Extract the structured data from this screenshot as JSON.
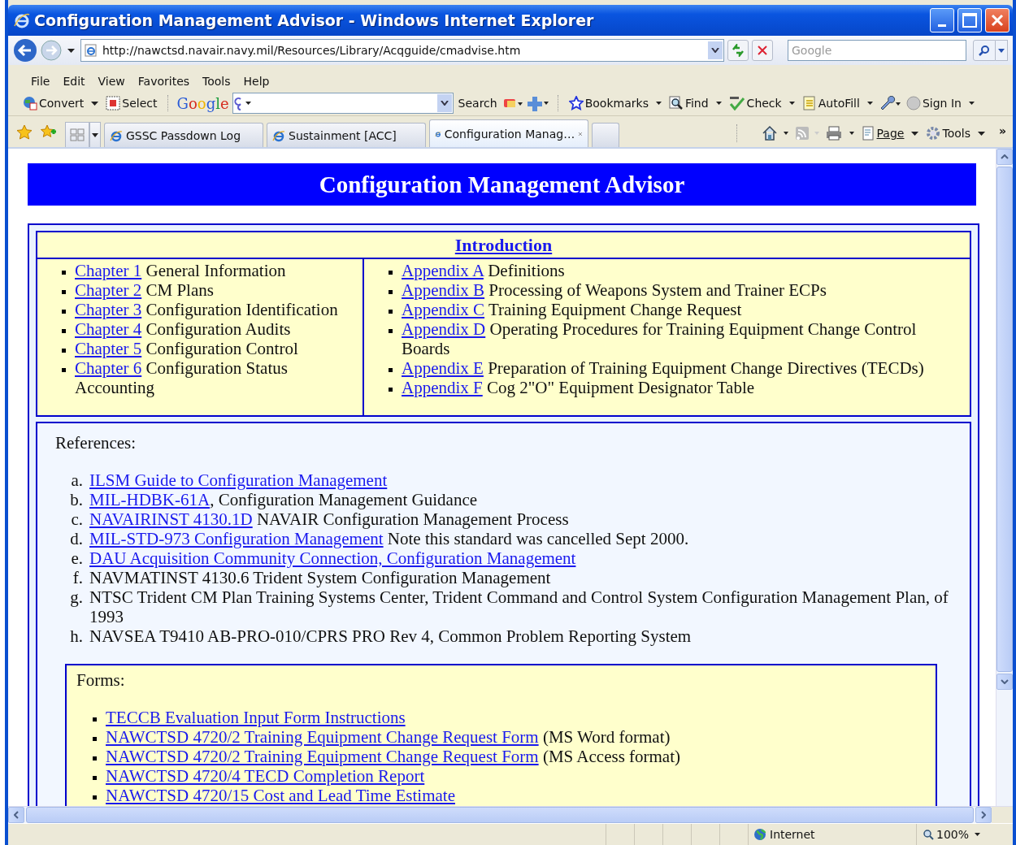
{
  "window": {
    "title": "Configuration Management Advisor - Windows Internet Explorer"
  },
  "address_bar": {
    "url": "http://nawctsd.navair.navy.mil/Resources/Library/Acqguide/cmadvise.htm"
  },
  "search_box": {
    "placeholder": "Google"
  },
  "menu": [
    "File",
    "Edit",
    "View",
    "Favorites",
    "Tools",
    "Help"
  ],
  "toolbar": {
    "items": [
      {
        "kind": "convert",
        "label": "Convert"
      },
      {
        "kind": "select",
        "label": "Select"
      }
    ],
    "logo": "Google",
    "search_label": "Search",
    "right_items": [
      {
        "kind": "bookmarks",
        "label": "Bookmarks"
      },
      {
        "kind": "find",
        "label": "Find"
      },
      {
        "kind": "check",
        "label": "Check"
      },
      {
        "kind": "autofill",
        "label": "AutoFill"
      },
      {
        "kind": "signin",
        "label": "Sign In"
      }
    ]
  },
  "tabs": [
    {
      "label": "GSSC Passdown Log",
      "selected": false
    },
    {
      "label": "Sustainment [ACC]",
      "selected": false
    },
    {
      "label": "Configuration Manag…",
      "selected": true
    }
  ],
  "command_bar": {
    "page": "Page",
    "tools": "Tools",
    "more": "»"
  },
  "page": {
    "heading": "Configuration Management Advisor",
    "intro": "Introduction",
    "chapters": [
      {
        "link": "Chapter 1",
        "text": "General Information"
      },
      {
        "link": "Chapter 2",
        "text": "CM Plans"
      },
      {
        "link": "Chapter 3",
        "text": "Configuration Identification"
      },
      {
        "link": "Chapter 4",
        "text": "Configuration Audits"
      },
      {
        "link": "Chapter 5",
        "text": "Configuration Control"
      },
      {
        "link": "Chapter 6",
        "text": "Configuration Status Accounting"
      }
    ],
    "appendices": [
      {
        "link": "Appendix A",
        "text": "Definitions"
      },
      {
        "link": "Appendix B",
        "text": "Processing of Weapons System and Trainer ECPs"
      },
      {
        "link": "Appendix C",
        "text": "Training Equipment Change Request"
      },
      {
        "link": "Appendix D",
        "text": "Operating Procedures for Training Equipment Change Control Boards"
      },
      {
        "link": "Appendix E",
        "text": "Preparation of Training Equipment Change Directives (TECDs)"
      },
      {
        "link": "Appendix F",
        "text": "Cog 2\"O\" Equipment Designator Table"
      }
    ],
    "references": {
      "label": "References:",
      "items": [
        {
          "marker": "a.",
          "link": "ILSM Guide to Configuration Management"
        },
        {
          "marker": "b.",
          "link": "MIL-HDBK-61A",
          "text": ", Configuration Management Guidance",
          "tight": true
        },
        {
          "marker": "c.",
          "link": "NAVAIRINST 4130.1D",
          "text": "NAVAIR Configuration Management Process"
        },
        {
          "marker": "d.",
          "link": "MIL-STD-973 Configuration Management",
          "text": "Note this standard was cancelled Sept 2000."
        },
        {
          "marker": "e.",
          "link": "DAU Acquisition Community Connection, Configuration Management"
        },
        {
          "marker": "f.",
          "text": "NAVMATINST 4130.6 Trident System Configuration Management"
        },
        {
          "marker": "g.",
          "text": "NTSC Trident CM Plan Training Systems Center, Trident Command and Control System Configuration Management Plan, of 1993"
        },
        {
          "marker": "h.",
          "text": "NAVSEA T9410 AB-PRO-010/CPRS PRO Rev 4, Common Problem Reporting System"
        }
      ]
    },
    "forms": {
      "label": "Forms:",
      "items": [
        {
          "link": "TECCB Evaluation Input Form Instructions"
        },
        {
          "link": "NAWCTSD 4720/2 Training Equipment Change Request Form",
          "text": "(MS Word format)"
        },
        {
          "link": "NAWCTSD 4720/2 Training Equipment Change Request Form",
          "text": "(MS Access format)"
        },
        {
          "link": "NAWCTSD 4720/4 TECD Completion Report"
        },
        {
          "link": "NAWCTSD 4720/15 Cost and Lead Time Estimate"
        }
      ]
    }
  },
  "status_bar": {
    "zone": "Internet",
    "zoom": "100%"
  }
}
